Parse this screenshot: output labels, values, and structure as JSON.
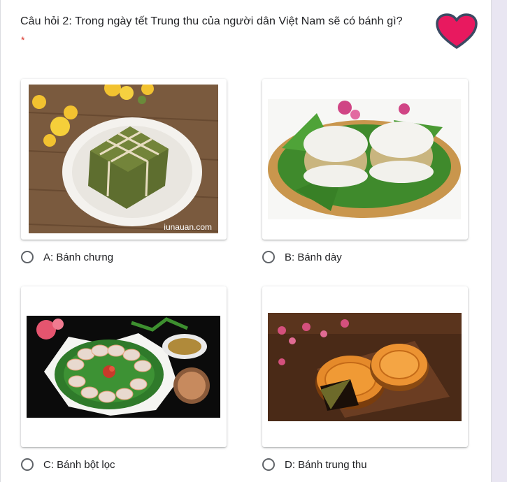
{
  "question": {
    "title": "Câu hỏi 2: Trong ngày tết Trung thu của người dân Việt Nam sẽ có bánh gì?",
    "required_marker": "*"
  },
  "options": [
    {
      "label": "A: Bánh chưng",
      "image_watermark": "iunauan.com"
    },
    {
      "label": "B: Bánh dày"
    },
    {
      "label": "C: Bánh bột lọc"
    },
    {
      "label": "D: Bánh trung thu"
    }
  ],
  "colors": {
    "heart": "#e8195f",
    "heart_outline": "#3b4a63",
    "required": "#d93025",
    "radio_border": "#5f6368"
  }
}
